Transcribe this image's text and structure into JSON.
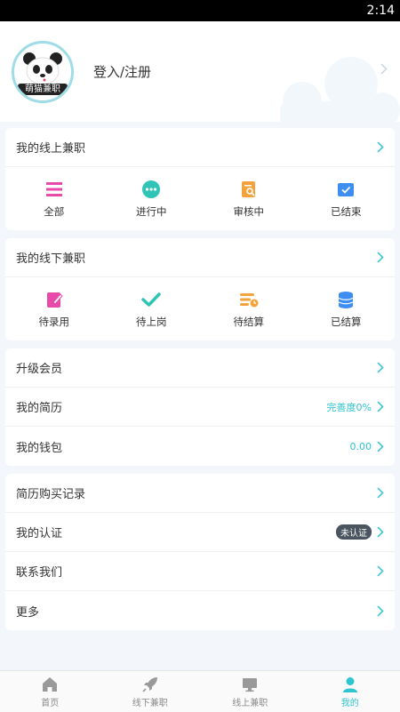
{
  "status": {
    "time": "2:14"
  },
  "header": {
    "login_text": "登入/注册",
    "brand_text": "萌猫兼职"
  },
  "online": {
    "title": "我的线上兼职",
    "items": [
      {
        "label": "全部",
        "icon": "list-icon",
        "color": "#e84aa9"
      },
      {
        "label": "进行中",
        "icon": "dots-icon",
        "color": "#2ec4b6"
      },
      {
        "label": "审核中",
        "icon": "review-doc-icon",
        "color": "#f4a23c"
      },
      {
        "label": "已结束",
        "icon": "checked-box-icon",
        "color": "#3d8ef0"
      }
    ]
  },
  "offline": {
    "title": "我的线下兼职",
    "items": [
      {
        "label": "待录用",
        "icon": "edit-icon",
        "color": "#e84aa9"
      },
      {
        "label": "待上岗",
        "icon": "check-icon",
        "color": "#2ec4b6"
      },
      {
        "label": "待结算",
        "icon": "pending-settle-icon",
        "color": "#f4a23c"
      },
      {
        "label": "已结算",
        "icon": "coins-stack-icon",
        "color": "#3d8ef0"
      }
    ]
  },
  "menu1": [
    {
      "label": "升级会员",
      "value": ""
    },
    {
      "label": "我的简历",
      "value": "完善度0%"
    },
    {
      "label": "我的钱包",
      "value": "0.00"
    }
  ],
  "menu2": [
    {
      "label": "简历购买记录",
      "value": ""
    },
    {
      "label": "我的认证",
      "value": "未认证"
    },
    {
      "label": "联系我们",
      "value": ""
    },
    {
      "label": "更多",
      "value": ""
    }
  ],
  "tabs": [
    {
      "label": "首页",
      "icon": "home-icon"
    },
    {
      "label": "线下兼职",
      "icon": "rocket-icon"
    },
    {
      "label": "线上兼职",
      "icon": "monitor-icon"
    },
    {
      "label": "我的",
      "icon": "person-icon",
      "active": true
    }
  ],
  "colors": {
    "accent": "#2ec4d0",
    "background": "#f3f7fb"
  }
}
